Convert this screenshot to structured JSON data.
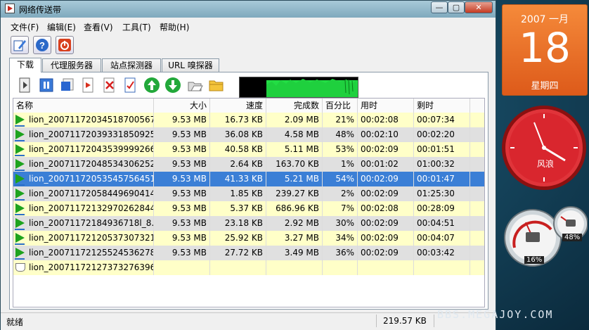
{
  "window": {
    "title": "网络传送带",
    "controls": {
      "minimize": "—",
      "maximize": "▢",
      "close": "✕"
    }
  },
  "menu": [
    "文件(F)",
    "编辑(E)",
    "查看(V)",
    "工具(T)",
    "帮助(H)"
  ],
  "tabs": [
    "下载",
    "代理服务器",
    "站点探测器",
    "URL 嗅探器"
  ],
  "active_tab": "下载",
  "columns": [
    "名称",
    "大小",
    "速度",
    "完成数",
    "百分比",
    "用时",
    "剩时"
  ],
  "rows": [
    {
      "name": "lion_20071172034518700567...",
      "size": "9.53 MB",
      "speed": "16.73 KB",
      "done": "2.09 MB",
      "pct": "21%",
      "elapsed": "00:02:08",
      "remain": "00:07:34",
      "state": "playing",
      "band": "yellow"
    },
    {
      "name": "lion_20071172039331850925...",
      "size": "9.53 MB",
      "speed": "36.08 KB",
      "done": "4.58 MB",
      "pct": "48%",
      "elapsed": "00:02:10",
      "remain": "00:02:20",
      "state": "playing",
      "band": "gray"
    },
    {
      "name": "lion_20071172043539999266...",
      "size": "9.53 MB",
      "speed": "40.58 KB",
      "done": "5.11 MB",
      "pct": "53%",
      "elapsed": "00:02:09",
      "remain": "00:01:51",
      "state": "playing",
      "band": "yellow"
    },
    {
      "name": "lion_20071172048534306252...",
      "size": "9.53 MB",
      "speed": "2.64 KB",
      "done": "163.70 KB",
      "pct": "1%",
      "elapsed": "00:01:02",
      "remain": "01:00:32",
      "state": "playing",
      "band": "gray"
    },
    {
      "name": "lion_20071172053545756451...",
      "size": "9.53 MB",
      "speed": "41.33 KB",
      "done": "5.21 MB",
      "pct": "54%",
      "elapsed": "00:02:09",
      "remain": "00:01:47",
      "state": "playing",
      "band": "selected"
    },
    {
      "name": "lion_20071172058449690414...",
      "size": "9.53 MB",
      "speed": "1.85 KB",
      "done": "239.27 KB",
      "pct": "2%",
      "elapsed": "00:02:09",
      "remain": "01:25:30",
      "state": "playing",
      "band": "gray"
    },
    {
      "name": "lion_20071172132970262844...",
      "size": "9.53 MB",
      "speed": "5.37 KB",
      "done": "686.96 KB",
      "pct": "7%",
      "elapsed": "00:02:08",
      "remain": "00:28:09",
      "state": "playing",
      "band": "yellow"
    },
    {
      "name": "lion_20071172184936718l_8...",
      "size": "9.53 MB",
      "speed": "23.18 KB",
      "done": "2.92 MB",
      "pct": "30%",
      "elapsed": "00:02:09",
      "remain": "00:04:51",
      "state": "playing",
      "band": "gray"
    },
    {
      "name": "lion_20071172120537307321...",
      "size": "9.53 MB",
      "speed": "25.92 KB",
      "done": "3.27 MB",
      "pct": "34%",
      "elapsed": "00:02:09",
      "remain": "00:04:07",
      "state": "playing",
      "band": "yellow"
    },
    {
      "name": "lion_20071172125524536278...",
      "size": "9.53 MB",
      "speed": "27.72 KB",
      "done": "3.49 MB",
      "pct": "36%",
      "elapsed": "00:02:09",
      "remain": "00:03:42",
      "state": "playing",
      "band": "gray"
    },
    {
      "name": "lion_20071172127373276396...",
      "size": "",
      "speed": "",
      "done": "",
      "pct": "",
      "elapsed": "",
      "remain": "",
      "state": "waiting",
      "band": "yellow"
    }
  ],
  "status": {
    "text": "就绪",
    "speed": "219.57 KB"
  },
  "calendar": {
    "year_month": "2007 一月",
    "day": "18",
    "weekday": "星期四"
  },
  "clock": {
    "label": "风浪"
  },
  "meters": {
    "cpu": "16%",
    "memory": "48%"
  },
  "watermark": "BBS.MEGAJOY.COM",
  "colors": {
    "selected": "#3b7fd6",
    "yellow_row": "#ffffc8",
    "gray_row": "#e0e0e0",
    "graph": "#22dd44",
    "calendar": "#ee6a22"
  }
}
